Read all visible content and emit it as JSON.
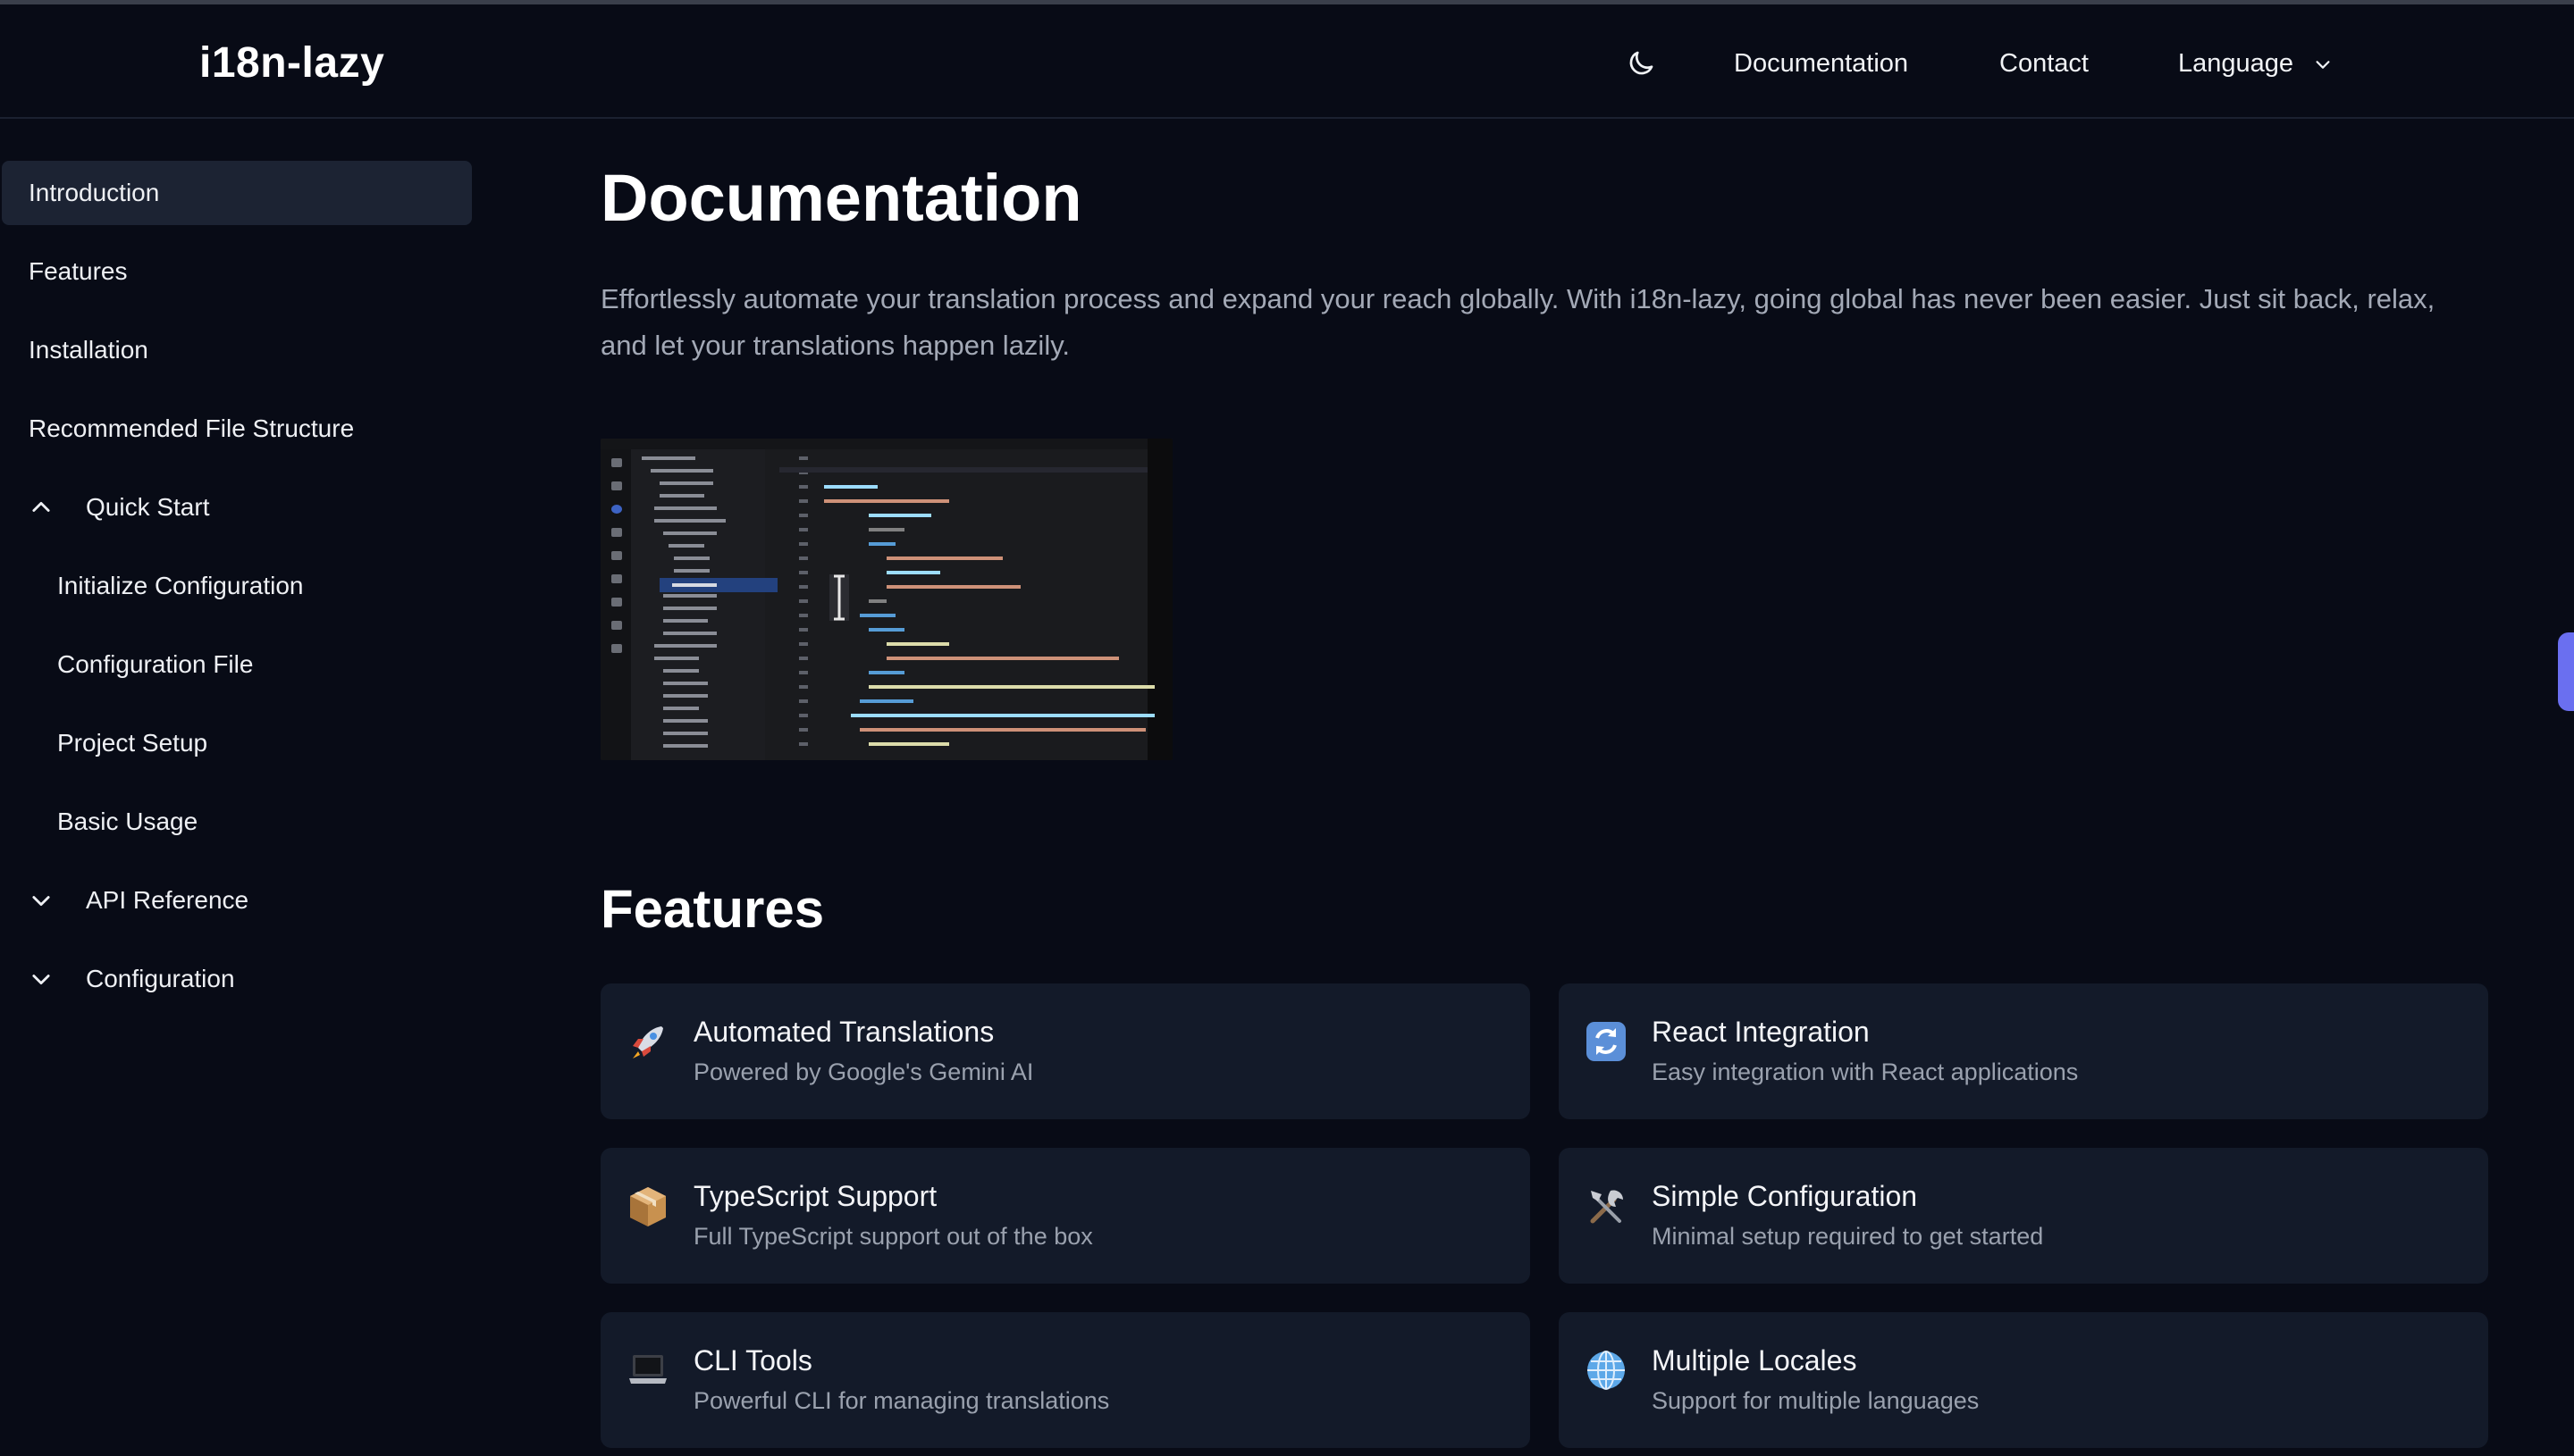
{
  "header": {
    "logo": "i18n-lazy",
    "nav": {
      "documentation": "Documentation",
      "contact": "Contact",
      "language": "Language"
    }
  },
  "sidebar": {
    "items": [
      {
        "label": "Introduction",
        "active": true
      },
      {
        "label": "Features"
      },
      {
        "label": "Installation"
      },
      {
        "label": "Recommended File Structure"
      }
    ],
    "quick_start": {
      "label": "Quick Start",
      "expanded": true,
      "children": [
        "Initialize Configuration",
        "Configuration File",
        "Project Setup",
        "Basic Usage"
      ]
    },
    "api_reference": {
      "label": "API Reference",
      "expanded": false
    },
    "configuration": {
      "label": "Configuration",
      "expanded": false
    }
  },
  "main": {
    "title": "Documentation",
    "lead": "Effortlessly automate your translation process and expand your reach globally. With i18n-lazy, going global has never been easier. Just sit back, relax, and let your translations happen lazily.",
    "features_title": "Features",
    "features": [
      {
        "icon": "rocket-icon",
        "title": "Automated Translations",
        "desc": "Powered by Google's Gemini AI"
      },
      {
        "icon": "refresh-icon",
        "title": "React Integration",
        "desc": "Easy integration with React applications"
      },
      {
        "icon": "package-icon",
        "title": "TypeScript Support",
        "desc": "Full TypeScript support out of the box"
      },
      {
        "icon": "tools-icon",
        "title": "Simple Configuration",
        "desc": "Minimal setup required to get started"
      },
      {
        "icon": "laptop-icon",
        "title": "CLI Tools",
        "desc": "Powerful CLI for managing translations"
      },
      {
        "icon": "globe-icon",
        "title": "Multiple Locales",
        "desc": "Support for multiple languages"
      }
    ]
  },
  "colors": {
    "background": "#080b16",
    "card": "#131a29",
    "active_nav": "#1c2333",
    "accent_tab": "#6a6ff0"
  }
}
